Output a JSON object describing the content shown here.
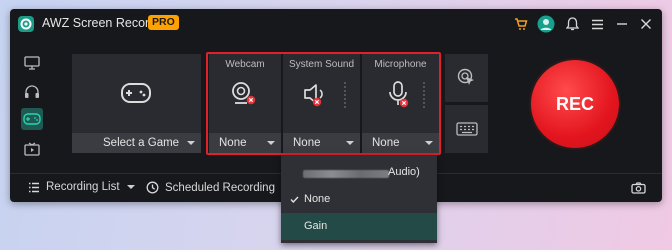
{
  "app": {
    "title": "AWZ Screen Recorder",
    "badge": "PRO"
  },
  "titlebar_icons": [
    "cart-icon",
    "avatar-icon",
    "bell-icon",
    "menu-icon",
    "minimize-icon",
    "close-icon"
  ],
  "sidebar": {
    "items": [
      {
        "name": "screen",
        "icon": "monitor-icon"
      },
      {
        "name": "audio",
        "icon": "headphones-icon"
      },
      {
        "name": "game",
        "icon": "gamepad-icon",
        "active": true
      },
      {
        "name": "tv",
        "icon": "tv-icon"
      }
    ]
  },
  "game_panel": {
    "select_label": "Select a Game"
  },
  "webcam": {
    "title": "Webcam",
    "value": "None"
  },
  "system_sound": {
    "title": "System Sound",
    "value": "None"
  },
  "microphone": {
    "title": "Microphone",
    "value": "None"
  },
  "tools": [
    {
      "icon": "cursor-click-icon"
    },
    {
      "icon": "keyboard-icon"
    }
  ],
  "rec_button": {
    "label": "REC"
  },
  "bottombar": {
    "recording_list": "Recording List",
    "scheduled_recording": "Scheduled Recording"
  },
  "dropdown": {
    "items": [
      {
        "label": "Audio)",
        "redacted": true
      },
      {
        "label": "None",
        "checked": true
      },
      {
        "label": "Gain",
        "highlighted": true
      }
    ]
  },
  "colors": {
    "accent": "#1f5a52",
    "rec": "#e3151e",
    "badge": "#ffa200",
    "highlight_box": "#e0202a"
  }
}
